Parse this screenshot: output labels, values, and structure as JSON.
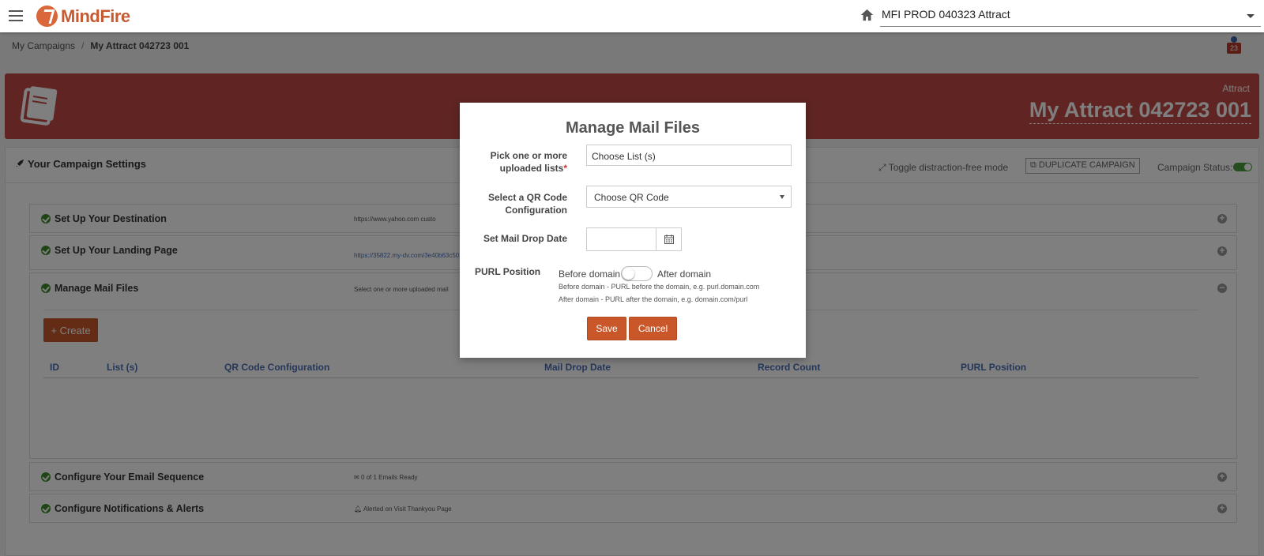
{
  "app": {
    "logo_text": "MindFire"
  },
  "topbar": {
    "account_selected": "MFI PROD 040323 Attract"
  },
  "breadcrumb": {
    "root": "My Campaigns",
    "separator": "/",
    "current": "My Attract 042723 001"
  },
  "notifications": {
    "count": "23"
  },
  "banner": {
    "type_label": "Attract",
    "title": "My Attract 042723 001",
    "color": "#c04a46"
  },
  "settings": {
    "title": "Your Campaign Settings",
    "toggle_distraction": "Toggle distraction-free mode",
    "duplicate_label": "DUPLICATE CAMPAIGN",
    "status_label": "Campaign Status:"
  },
  "sections": {
    "destination": {
      "title": "Set Up Your Destination",
      "info": "https://www.yahoo.com    custo"
    },
    "landing": {
      "title": "Set Up Your Landing Page",
      "info": "https://35822.my-dv.com/3e40b63c50"
    },
    "mail": {
      "title": "Manage Mail Files",
      "info": "Select one or more uploaded mail"
    },
    "email": {
      "title": "Configure Your Email Sequence",
      "info": "0 of 1 Emails Ready"
    },
    "alerts": {
      "title": "Configure Notifications & Alerts",
      "info": "Alerted on Visit Thankyou Page"
    }
  },
  "mail_files": {
    "create_label": "+ Create",
    "columns": [
      "ID",
      "List (s)",
      "QR Code Configuration",
      "Mail Drop Date",
      "Record Count",
      "PURL Position"
    ]
  },
  "modal": {
    "title": "Manage Mail Files",
    "lists_label_line1": "Pick one or more",
    "lists_label_line2": "uploaded lists",
    "required_mark": "*",
    "lists_value": "Choose List (s)",
    "qr_label_line1": "Select a QR Code",
    "qr_label_line2": "Configuration",
    "qr_value": "Choose QR Code",
    "drop_label": "Set Mail Drop Date",
    "drop_value": "",
    "purl_label": "PURL Position",
    "purl_before": "Before domain",
    "purl_after": "After domain",
    "purl_help_before": "Before domain - PURL before the domain, e.g. purl.domain.com",
    "purl_help_after": "After domain - PURL after the domain, e.g. domain.com/purl",
    "save_label": "Save",
    "cancel_label": "Cancel"
  },
  "colors": {
    "accent": "#c9572a",
    "success": "#3e8a2f",
    "link": "#4a6fb5"
  }
}
